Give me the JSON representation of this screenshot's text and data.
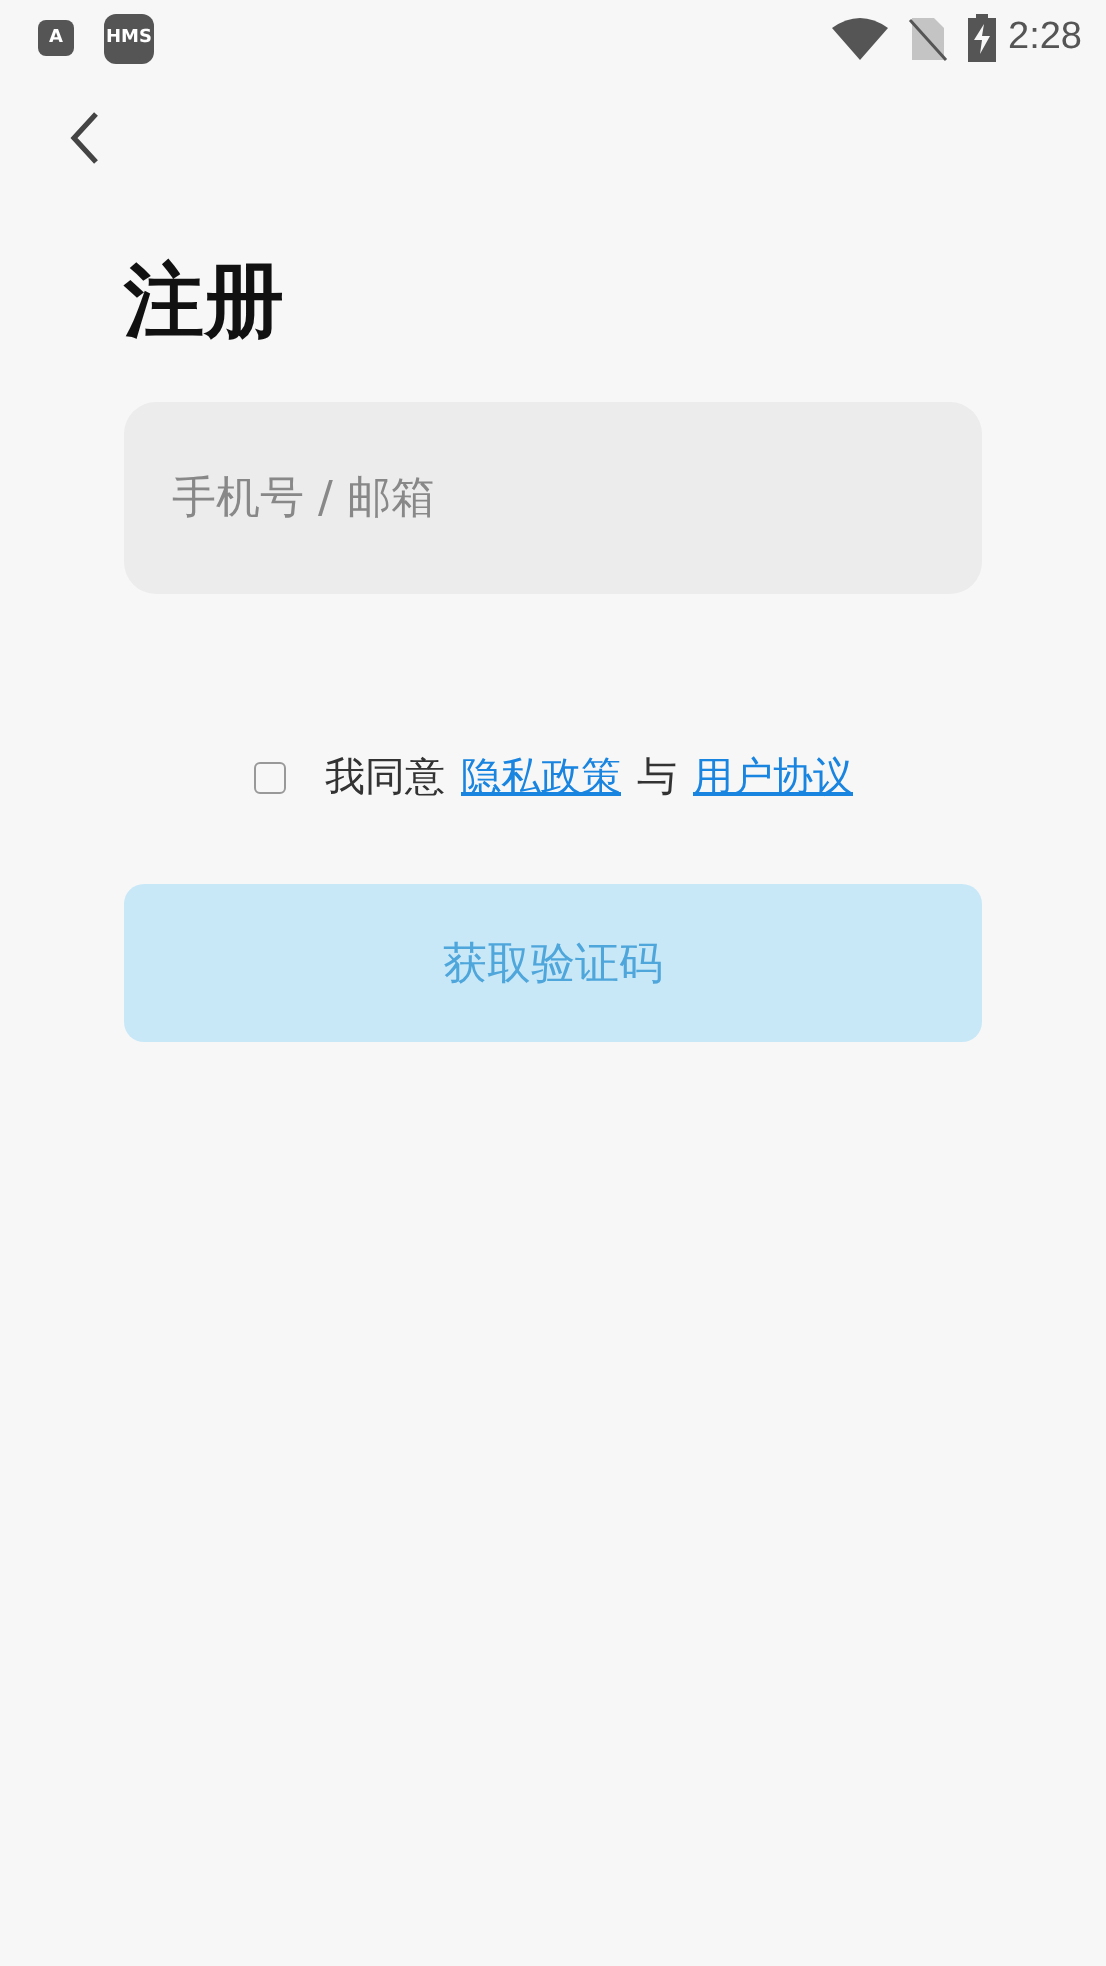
{
  "status_bar": {
    "app_icons": [
      "A",
      "HMS"
    ],
    "time": "2:28"
  },
  "title": "注册",
  "account_field": {
    "placeholder": "手机号 / 邮箱"
  },
  "agreement": {
    "checked": false,
    "parts": [
      {
        "kind": "text",
        "text": "我同意"
      },
      {
        "kind": "link",
        "text": "隐私政策"
      },
      {
        "kind": "text",
        "text": "与"
      },
      {
        "kind": "link",
        "text": "用户协议"
      }
    ]
  },
  "submit_button": {
    "label": "获取验证码",
    "disabled": true
  }
}
